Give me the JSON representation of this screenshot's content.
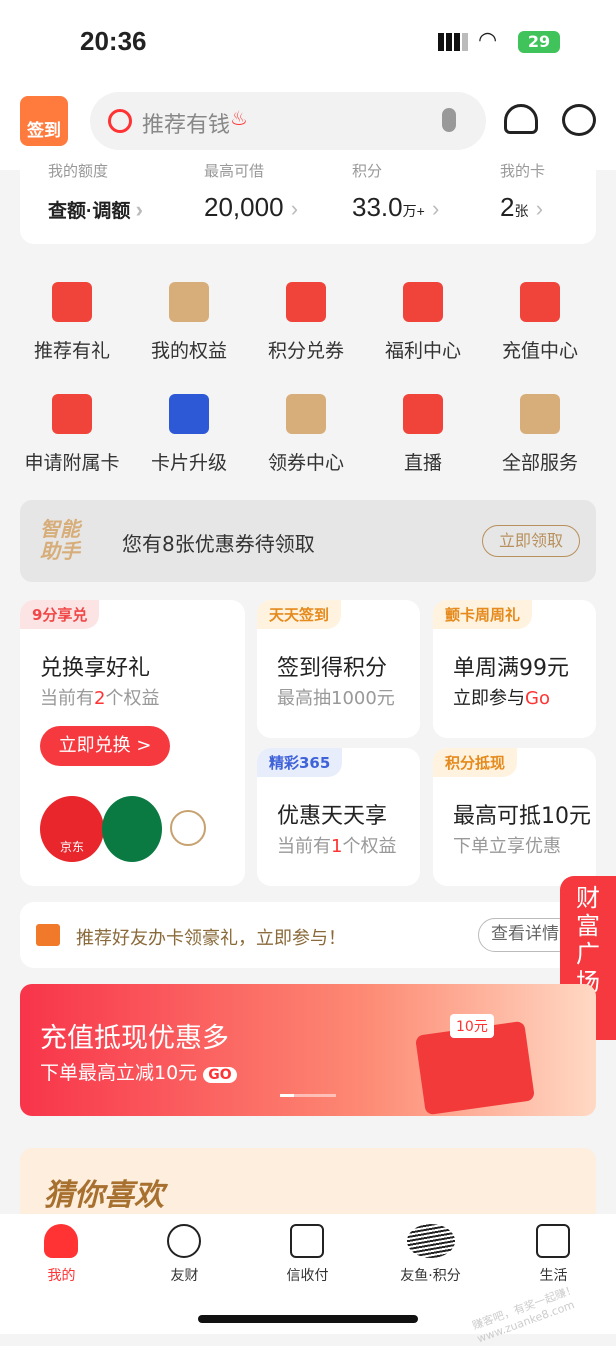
{
  "status": {
    "time": "20:36",
    "battery": "29"
  },
  "header": {
    "sign_label": "签到",
    "search_placeholder": "推荐有钱"
  },
  "stats": [
    {
      "label": "我的额度",
      "value": "查额·调额",
      "unit": ""
    },
    {
      "label": "最高可借",
      "value": "20,000",
      "unit": ""
    },
    {
      "label": "积分",
      "value": "33.0",
      "unit": "万+"
    },
    {
      "label": "我的卡",
      "value": "2",
      "unit": "张"
    }
  ],
  "services": [
    {
      "label": "推荐有礼",
      "icon": "gift-icon",
      "color": "#f0443a"
    },
    {
      "label": "我的权益",
      "icon": "diamond-icon",
      "color": "#d7ae7a"
    },
    {
      "label": "积分兑券",
      "icon": "coupon-icon",
      "color": "#f0443a"
    },
    {
      "label": "福利中心",
      "icon": "red-envelope-icon",
      "color": "#f0443a"
    },
    {
      "label": "充值中心",
      "icon": "recharge-icon",
      "color": "#f0443a"
    },
    {
      "label": "申请附属卡",
      "icon": "card-stack-icon",
      "color": "#f0443a"
    },
    {
      "label": "卡片升级",
      "icon": "upgrade-icon",
      "color": "#2d58d6"
    },
    {
      "label": "领券中心",
      "icon": "ticket-icon",
      "color": "#d7ae7a"
    },
    {
      "label": "直播",
      "icon": "live-icon",
      "color": "#f0443a"
    },
    {
      "label": "全部服务",
      "icon": "grid-icon",
      "color": "#d7ae7a"
    }
  ],
  "assistant": {
    "logo": "智能助手",
    "text": "您有8张优惠券待领取",
    "button": "立即领取"
  },
  "promo": {
    "big": {
      "tag": "9分享兑",
      "title": "兑换享好礼",
      "sub_pre": "当前有",
      "sub_num": "2",
      "sub_post": "个权益",
      "button": "立即兑换 >",
      "brand": "京东"
    },
    "cards": [
      {
        "tag": "天天签到",
        "tag_color": "#e58a1c",
        "tag_bg": "#fff3e0",
        "title": "签到得积分",
        "sub": "最高抽1000元"
      },
      {
        "tag": "颤卡周周礼",
        "tag_color": "#e58a1c",
        "tag_bg": "#fff3e0",
        "title": "单周满99元",
        "sub": "立即参与",
        "sub_go": "Go"
      },
      {
        "tag": "精彩365",
        "tag_color": "#3f62d8",
        "tag_bg": "#e8edfc",
        "title": "优惠天天享",
        "sub_pre": "当前有",
        "sub_num": "1",
        "sub_post": "个权益"
      },
      {
        "tag": "积分抵现",
        "tag_color": "#e58a1c",
        "tag_bg": "#fff3e0",
        "title": "最高可抵10元",
        "sub": "下单立享优惠"
      }
    ]
  },
  "referral": {
    "text": "推荐好友办卡领豪礼，立即参与！",
    "button": "查看详情"
  },
  "side_float": {
    "text": "财富广场",
    "arrow": "<"
  },
  "banner": {
    "title": "充值抵现优惠多",
    "sub": "下单最高立减10元",
    "go": "GO",
    "coupon": "10元"
  },
  "guess": {
    "title": "猜你喜欢"
  },
  "tabbar": [
    {
      "label": "我的",
      "active": true
    },
    {
      "label": "友财"
    },
    {
      "label": "信收付"
    },
    {
      "label": "友鱼·积分"
    },
    {
      "label": "生活"
    }
  ],
  "watermark": "赚客吧，有奖一起赚！ www.zuanke8.com"
}
